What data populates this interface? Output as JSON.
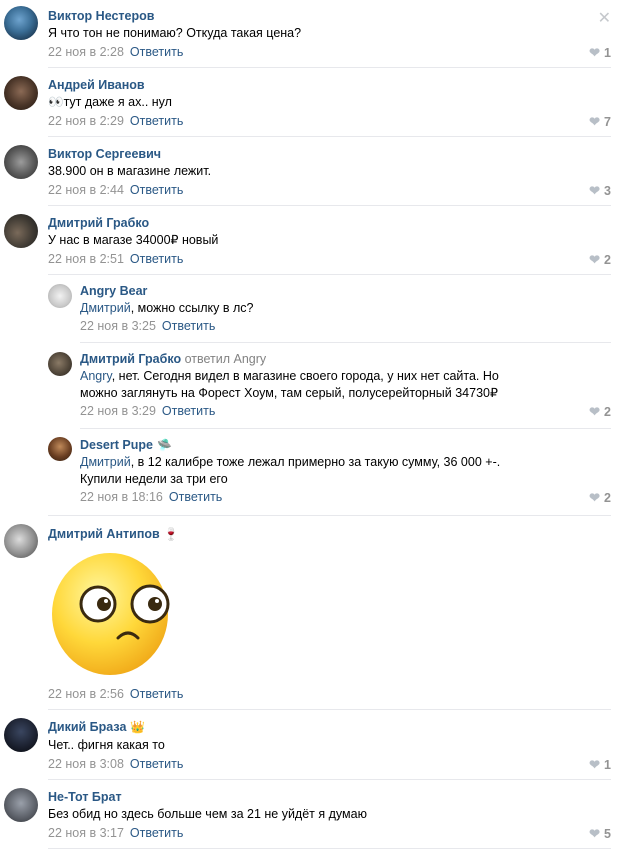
{
  "close_icon": "✕",
  "reply_label": "Ответить",
  "heart_icon": "❤",
  "comments": [
    {
      "author": "Виктор Нестеров",
      "text": "Я что тон не понимаю? Откуда такая цена?",
      "time": "22 ноя в 2:28",
      "likes": "1"
    },
    {
      "author": "Андрей Иванов",
      "text": "👀тут даже я ах.. нул",
      "time": "22 ноя в 2:29",
      "likes": "7"
    },
    {
      "author": "Виктор Сергеевич",
      "text": "38.900 он в магазине лежит.",
      "time": "22 ноя в 2:44",
      "likes": "3"
    },
    {
      "author": "Дмитрий Грабко",
      "text": "У нас в магазе 34000₽ новый",
      "time": "22 ноя в 2:51",
      "likes": "2"
    },
    {
      "author": "Angry Bear",
      "mention": "Дмитрий",
      "text": ", можно ссылку в лс?",
      "time": "22 ноя в 3:25",
      "likes": ""
    },
    {
      "author": "Дмитрий Грабко",
      "replied_to": "ответил Angry",
      "mention": "Angry",
      "text": ", нет. Сегодня видел в магазине своего города, у них нет сайта. Но можно заглянуть на Форест Хоум, там серый, полусерейторный 34730₽",
      "time": "22 ноя в 3:29",
      "likes": "2"
    },
    {
      "author": "Desert Pupe",
      "badge": "🛸",
      "mention": "Дмитрий",
      "text": ", в 12 калибре тоже лежал примерно за такую сумму, 36 000 +-. Купили недели за три его",
      "time": "22 ноя в 18:16",
      "likes": "2"
    },
    {
      "author": "Дмитрий Антипов",
      "badge": "🍷",
      "sticker": "confused-emoji-sticker",
      "time": "22 ноя в 2:56",
      "likes": ""
    },
    {
      "author": "Дикий Браза",
      "badge": "👑",
      "text": "Чет.. фигня какая то",
      "time": "22 ноя в 3:08",
      "likes": "1"
    },
    {
      "author": "Не-Тот Брат",
      "text": "Без обид но здесь больше чем за 21 не уйдёт я думаю",
      "time": "22 ноя в 3:17",
      "likes": "5"
    }
  ]
}
